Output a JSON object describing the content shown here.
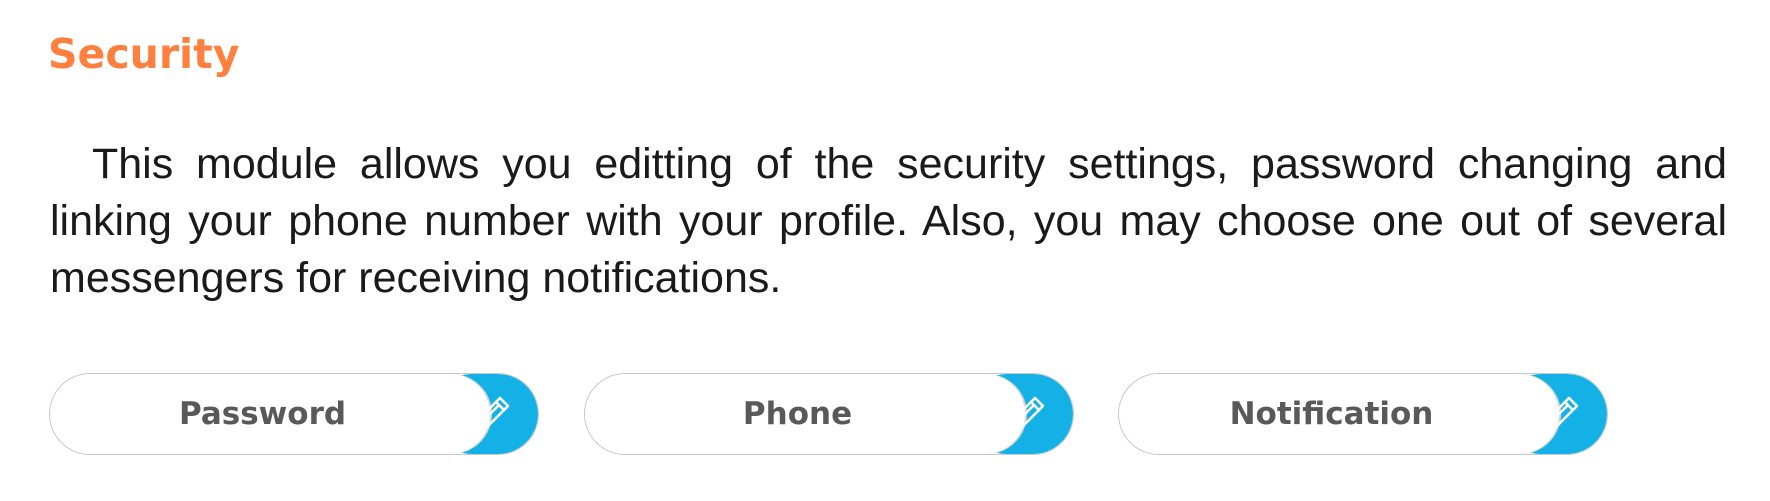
{
  "section": {
    "title": "Security",
    "description": "This module allows you editting of the security settings, password changing and linking your phone number with your profile. Also, you may choose one out of several messengers for receiving notifications."
  },
  "actions": [
    {
      "label": "Password",
      "icon": "pencil-icon"
    },
    {
      "label": "Phone",
      "icon": "pencil-icon"
    },
    {
      "label": "Notification",
      "icon": "pencil-icon"
    }
  ],
  "colors": {
    "title": "#ff7f3f",
    "accent": "#14b1e6",
    "label": "#595959",
    "border": "#c9c9c9"
  }
}
